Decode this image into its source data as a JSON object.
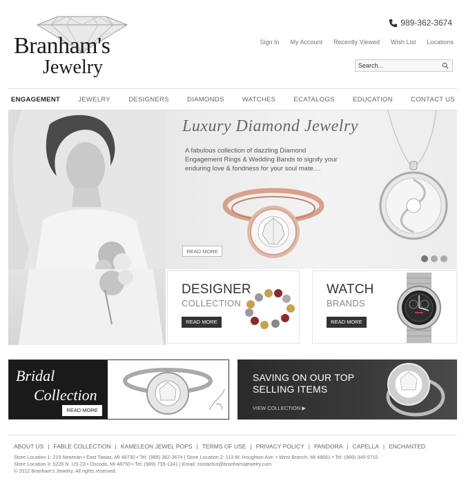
{
  "header": {
    "brand_line1": "Branham's",
    "brand_line2": "Jewelry",
    "phone": "989-362-3674",
    "utility_links": [
      "Sign In",
      "My Account",
      "Recently Viewed",
      "Wish List",
      "Locations"
    ],
    "search_value": "Search..."
  },
  "nav": {
    "items": [
      "ENGAGEMENT",
      "JEWELRY",
      "DESIGNERS",
      "DIAMONDS",
      "WATCHES",
      "ECATALOGS",
      "EDUCATION",
      "CONTACT US"
    ],
    "active": "ENGAGEMENT"
  },
  "hero": {
    "title": "Luxury Diamond Jewelry",
    "description": "A fabulous collection of dazzling Diamond Engagement Rings & Wedding Bands to signify your enduring love & fondness for your soul mate....",
    "button": "READ MORE",
    "slides": 3,
    "active_slide": 1
  },
  "promos": {
    "designer": {
      "line1": "DESIGNER",
      "line2": "COLLECTION",
      "button": "READ MORE"
    },
    "watch": {
      "line1": "WATCH",
      "line2": "BRANDS",
      "button": "READ MORE"
    }
  },
  "banners": {
    "bridal": {
      "line1": "Bridal",
      "line2": "Collection",
      "button": "READ MORE"
    },
    "saving": {
      "line1": "SAVING ON OUR TOP",
      "line2": "SELLING ITEMS",
      "link": "VIEW COLLECTION ▶"
    }
  },
  "footer": {
    "links": [
      "ABOUT US",
      "FABLE COLLECTION",
      "KAMELEON JEWEL POPS",
      "TERMS OF USE",
      "PRIVACY POLICY",
      "PANDORA",
      "CAPELLA",
      "ENCHANTED"
    ],
    "line1": "Store Location 1: 219 Newman • East Tawas, MI 48730 • Tel: (989) 362-3674  |  Store Location 2: 113 W. Houghton Ave. • West Branch, MI 48661 • Tel: (989) 345-5710",
    "line2": "Store Location 3: 5226 N. US-23 • Oscoda, MI 48750 • Tel: (989) 739-1341  |  Email: contactus@branhamsjewelry.com",
    "line3": "© 2012 Branham's Jewelry, All rights reserved."
  },
  "colors": {
    "dark_button": "#333333",
    "banner_dark": "#1a1a1a",
    "rose_gold": "#d9a08a"
  }
}
